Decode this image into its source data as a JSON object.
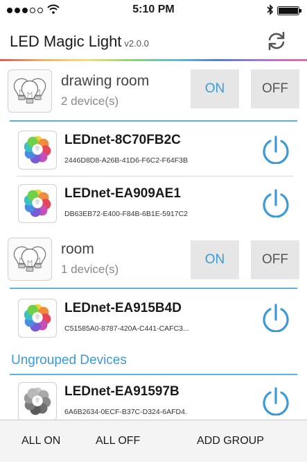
{
  "status_bar": {
    "time": "5:10 PM"
  },
  "header": {
    "title": "LED Magic Light",
    "version": "v2.0.0"
  },
  "groups": [
    {
      "name": "drawing room",
      "count": "2 device(s)",
      "on_label": "ON",
      "off_label": "OFF",
      "devices": [
        {
          "name": "LEDnet-8C70FB2C",
          "id": "2446D8D8-A26B-41D6-F6C2-F64F3B"
        },
        {
          "name": "LEDnet-EA909AE1",
          "id": "DB63EB72-E400-F84B-6B1E-5917C2"
        }
      ]
    },
    {
      "name": "room",
      "count": "1 device(s)",
      "on_label": "ON",
      "off_label": "OFF",
      "devices": [
        {
          "name": "LEDnet-EA915B4D",
          "id": "C51585A0-8787-420A-C441-CAFC3..."
        }
      ]
    }
  ],
  "ungrouped": {
    "header": "Ungrouped Devices",
    "devices": [
      {
        "name": "LEDnet-EA91597B",
        "id": "6A6B2634-0ECF-B37C-D324-6AFD4."
      }
    ]
  },
  "bottom_bar": {
    "all_on": "ALL ON",
    "all_off": "ALL OFF",
    "add_group": "ADD GROUP"
  },
  "colors": {
    "accent": "#3b9ad9",
    "divider": "#5fb0e0",
    "button_bg": "#e6e6e6"
  },
  "icons": {
    "group": "bulbs-group-icon",
    "device": "color-wheel-bulb-icon",
    "power": "power-icon",
    "refresh": "refresh-icon"
  }
}
